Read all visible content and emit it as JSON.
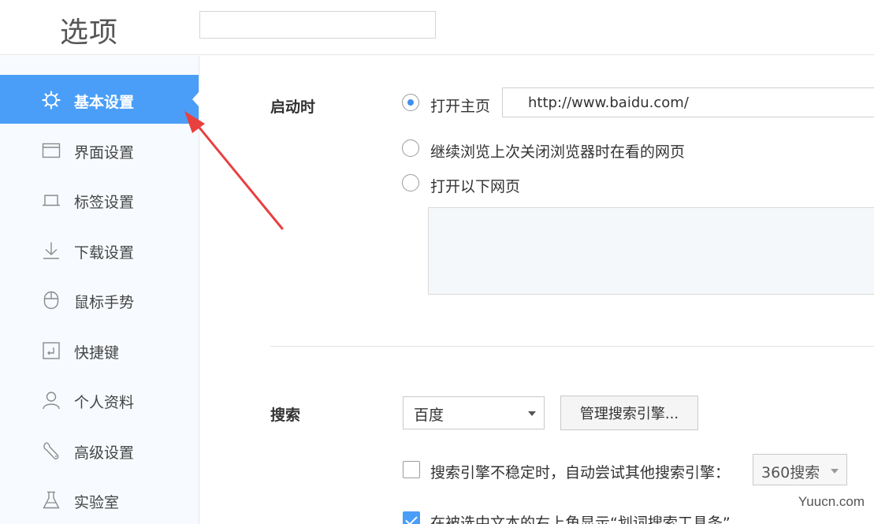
{
  "header": {
    "title": "选项",
    "search_value": ""
  },
  "sidebar": {
    "active_index": 0,
    "items": [
      {
        "label": "基本设置",
        "icon": "gear-icon"
      },
      {
        "label": "界面设置",
        "icon": "window-icon"
      },
      {
        "label": "标签设置",
        "icon": "tab-icon"
      },
      {
        "label": "下载设置",
        "icon": "download-icon"
      },
      {
        "label": "鼠标手势",
        "icon": "mouse-icon"
      },
      {
        "label": "快捷键",
        "icon": "shortcut-icon"
      },
      {
        "label": "个人资料",
        "icon": "user-icon"
      },
      {
        "label": "高级设置",
        "icon": "wrench-icon"
      },
      {
        "label": "实验室",
        "icon": "flask-icon"
      }
    ]
  },
  "startup": {
    "label": "启动时",
    "options": [
      {
        "label": "打开主页",
        "checked": true
      },
      {
        "label": "继续浏览上次关闭浏览器时在看的网页",
        "checked": false
      },
      {
        "label": "打开以下网页",
        "checked": false
      }
    ],
    "homepage_url": "http://www.baidu.com/"
  },
  "search": {
    "label": "搜索",
    "engine_selected": "百度",
    "manage_button": "管理搜索引擎...",
    "fallback_checkbox": {
      "label": "搜索引擎不稳定时，自动尝试其他搜索引擎：",
      "checked": false
    },
    "fallback_engine": "360搜索",
    "selection_checkbox": {
      "label": "在被选中文本的右上角显示“划词搜索工具条”",
      "checked": true
    }
  },
  "colors": {
    "accent": "#4a9ef7",
    "annotation": "#e8403f"
  },
  "watermark": "Yuucn.com"
}
